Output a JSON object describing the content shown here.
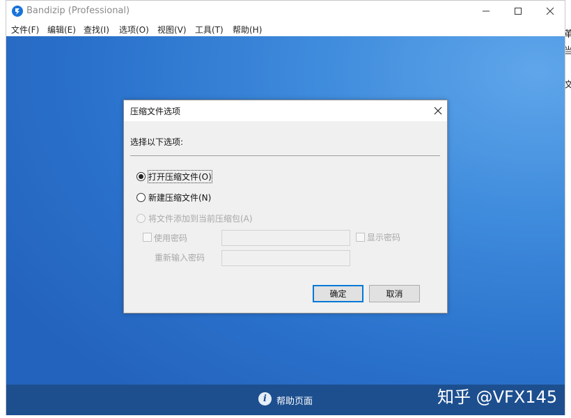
{
  "app": {
    "title": "Bandizip (Professional)"
  },
  "menu": [
    "文件(F)",
    "编辑(E)",
    "查找(I)",
    "选项(O)",
    "视图(V)",
    "工具(T)",
    "帮助(H)"
  ],
  "statusbar": {
    "help_label": "帮助页面",
    "help_icon": "info-icon"
  },
  "watermark": "知乎 @VFX145",
  "right_edge_chars": [
    "革",
    "当",
    "文"
  ],
  "dialog": {
    "title": "压缩文件选项",
    "prompt": "选择以下选项:",
    "options": [
      {
        "label": "打开压缩文件(O)",
        "checked": true,
        "enabled": true
      },
      {
        "label": "新建压缩文件(N)",
        "checked": false,
        "enabled": true
      },
      {
        "label": "将文件添加到当前压缩包(A)",
        "checked": false,
        "enabled": false
      }
    ],
    "use_password_label": "使用密码",
    "show_password_label": "显示密码",
    "reenter_password_label": "重新输入密码",
    "ok_label": "确定",
    "cancel_label": "取消"
  },
  "colors": {
    "accent": "#0078d7",
    "statusbar": "#1d4f8f",
    "workspace": "#2a72cc"
  }
}
